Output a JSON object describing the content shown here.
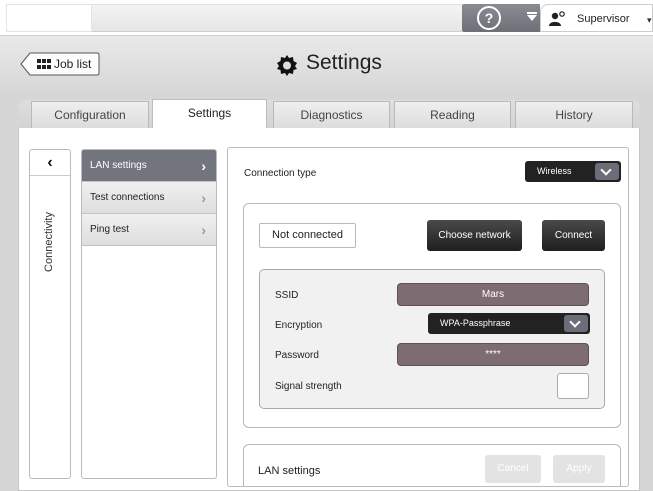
{
  "topbar": {
    "user_role": "Supervisor"
  },
  "header": {
    "back_label": "Job list",
    "title": "Settings"
  },
  "tabs": [
    {
      "label": "Configuration",
      "active": false
    },
    {
      "label": "Settings",
      "active": true
    },
    {
      "label": "Diagnostics",
      "active": false
    },
    {
      "label": "Reading",
      "active": false
    },
    {
      "label": "History",
      "active": false
    }
  ],
  "side_nav": {
    "section_label": "Connectivity",
    "items": [
      {
        "label": "LAN settings",
        "active": true
      },
      {
        "label": "Test connections",
        "active": false
      },
      {
        "label": "Ping test",
        "active": false
      }
    ]
  },
  "connection": {
    "type_label": "Connection type",
    "type_value": "Wireless",
    "status": "Not connected",
    "choose_network_label": "Choose network",
    "connect_label": "Connect",
    "ssid_label": "SSID",
    "ssid_value": "Mars",
    "encryption_label": "Encryption",
    "encryption_value": "WPA-Passphrase",
    "password_label": "Password",
    "password_value": "****",
    "signal_label": "Signal strength"
  },
  "lan": {
    "label": "LAN settings",
    "cancel_label": "Cancel",
    "apply_label": "Apply"
  },
  "colors": {
    "active_nav": "#72747e",
    "field_fill": "#7d6c72",
    "dark_button": "#222222"
  }
}
